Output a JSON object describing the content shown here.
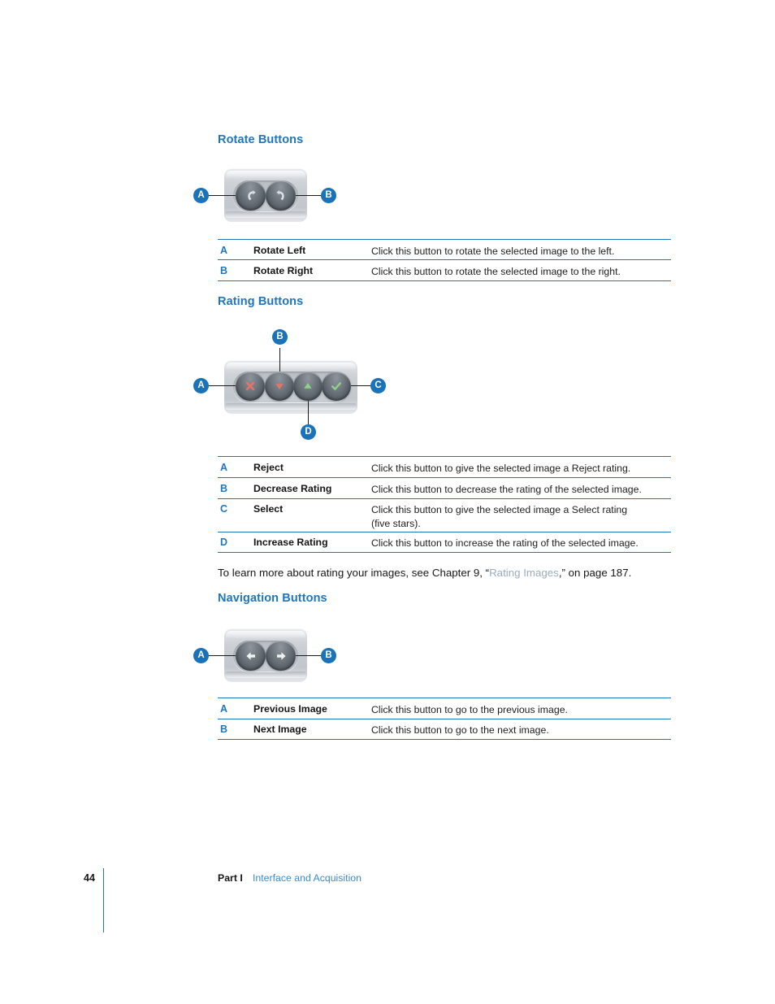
{
  "page": {
    "number": "44",
    "footer_part": "Part I",
    "footer_title": "Interface and Acquisition"
  },
  "colors": {
    "heading_blue": "#1f76bc",
    "callout_blue": "#1a72b8",
    "rule_blue": "#1f76bc",
    "xref_gray": "#9aaebd",
    "footer_link_blue": "#3b8cce",
    "reject_red": "#e8736a",
    "select_green": "#8fd18a",
    "widget_body": "#c6cbd1",
    "button_dark": "#5a6168"
  },
  "sections": [
    {
      "id": "rotate",
      "heading": "Rotate Buttons",
      "figure": {
        "name": "rotate-buttons-widget",
        "buttons": [
          {
            "name": "rotate-left-button",
            "icon": "rotate-left-icon"
          },
          {
            "name": "rotate-right-button",
            "icon": "rotate-right-icon"
          }
        ],
        "callouts": [
          {
            "letter": "A",
            "target": "rotate-left-button"
          },
          {
            "letter": "B",
            "target": "rotate-right-button"
          }
        ]
      },
      "rows": [
        {
          "key": "A",
          "label": "Rotate Left",
          "description": "Click this button to rotate the selected image to the left."
        },
        {
          "key": "B",
          "label": "Rotate Right",
          "description": "Click this button to rotate the selected image to the right."
        }
      ]
    },
    {
      "id": "rating",
      "heading": "Rating Buttons",
      "figure": {
        "name": "rating-buttons-widget",
        "buttons": [
          {
            "name": "reject-button",
            "icon": "x-mark-icon"
          },
          {
            "name": "decrease-rating-button",
            "icon": "triangle-down-icon"
          },
          {
            "name": "increase-rating-button",
            "icon": "triangle-up-icon"
          },
          {
            "name": "select-button",
            "icon": "check-mark-icon"
          }
        ],
        "callouts": [
          {
            "letter": "A",
            "target": "reject-button"
          },
          {
            "letter": "B",
            "target": "decrease-rating-button"
          },
          {
            "letter": "C",
            "target": "select-button"
          },
          {
            "letter": "D",
            "target": "increase-rating-button"
          }
        ]
      },
      "rows": [
        {
          "key": "A",
          "label": "Reject",
          "description": "Click this button to give the selected image a Reject rating."
        },
        {
          "key": "B",
          "label": "Decrease Rating",
          "description": "Click this button to decrease the rating of the selected image."
        },
        {
          "key": "C",
          "label": "Select",
          "description": "Click this button to give the selected image a Select rating\n(five stars)."
        },
        {
          "key": "D",
          "label": "Increase Rating",
          "description": "Click this button to increase the rating of the selected image."
        }
      ]
    },
    {
      "id": "navigation",
      "heading": "Navigation Buttons",
      "figure": {
        "name": "navigation-buttons-widget",
        "buttons": [
          {
            "name": "previous-image-button",
            "icon": "arrow-left-icon"
          },
          {
            "name": "next-image-button",
            "icon": "arrow-right-icon"
          }
        ],
        "callouts": [
          {
            "letter": "A",
            "target": "previous-image-button"
          },
          {
            "letter": "B",
            "target": "next-image-button"
          }
        ]
      },
      "rows": [
        {
          "key": "A",
          "label": "Previous Image",
          "description": "Click this button to go to the previous image."
        },
        {
          "key": "B",
          "label": "Next Image",
          "description": "Click this button to go to the next image."
        }
      ]
    }
  ],
  "paragraph": {
    "before": "To learn more about rating your images, see Chapter 9, “",
    "xref": "Rating Images",
    "after": ",” on page 187."
  }
}
